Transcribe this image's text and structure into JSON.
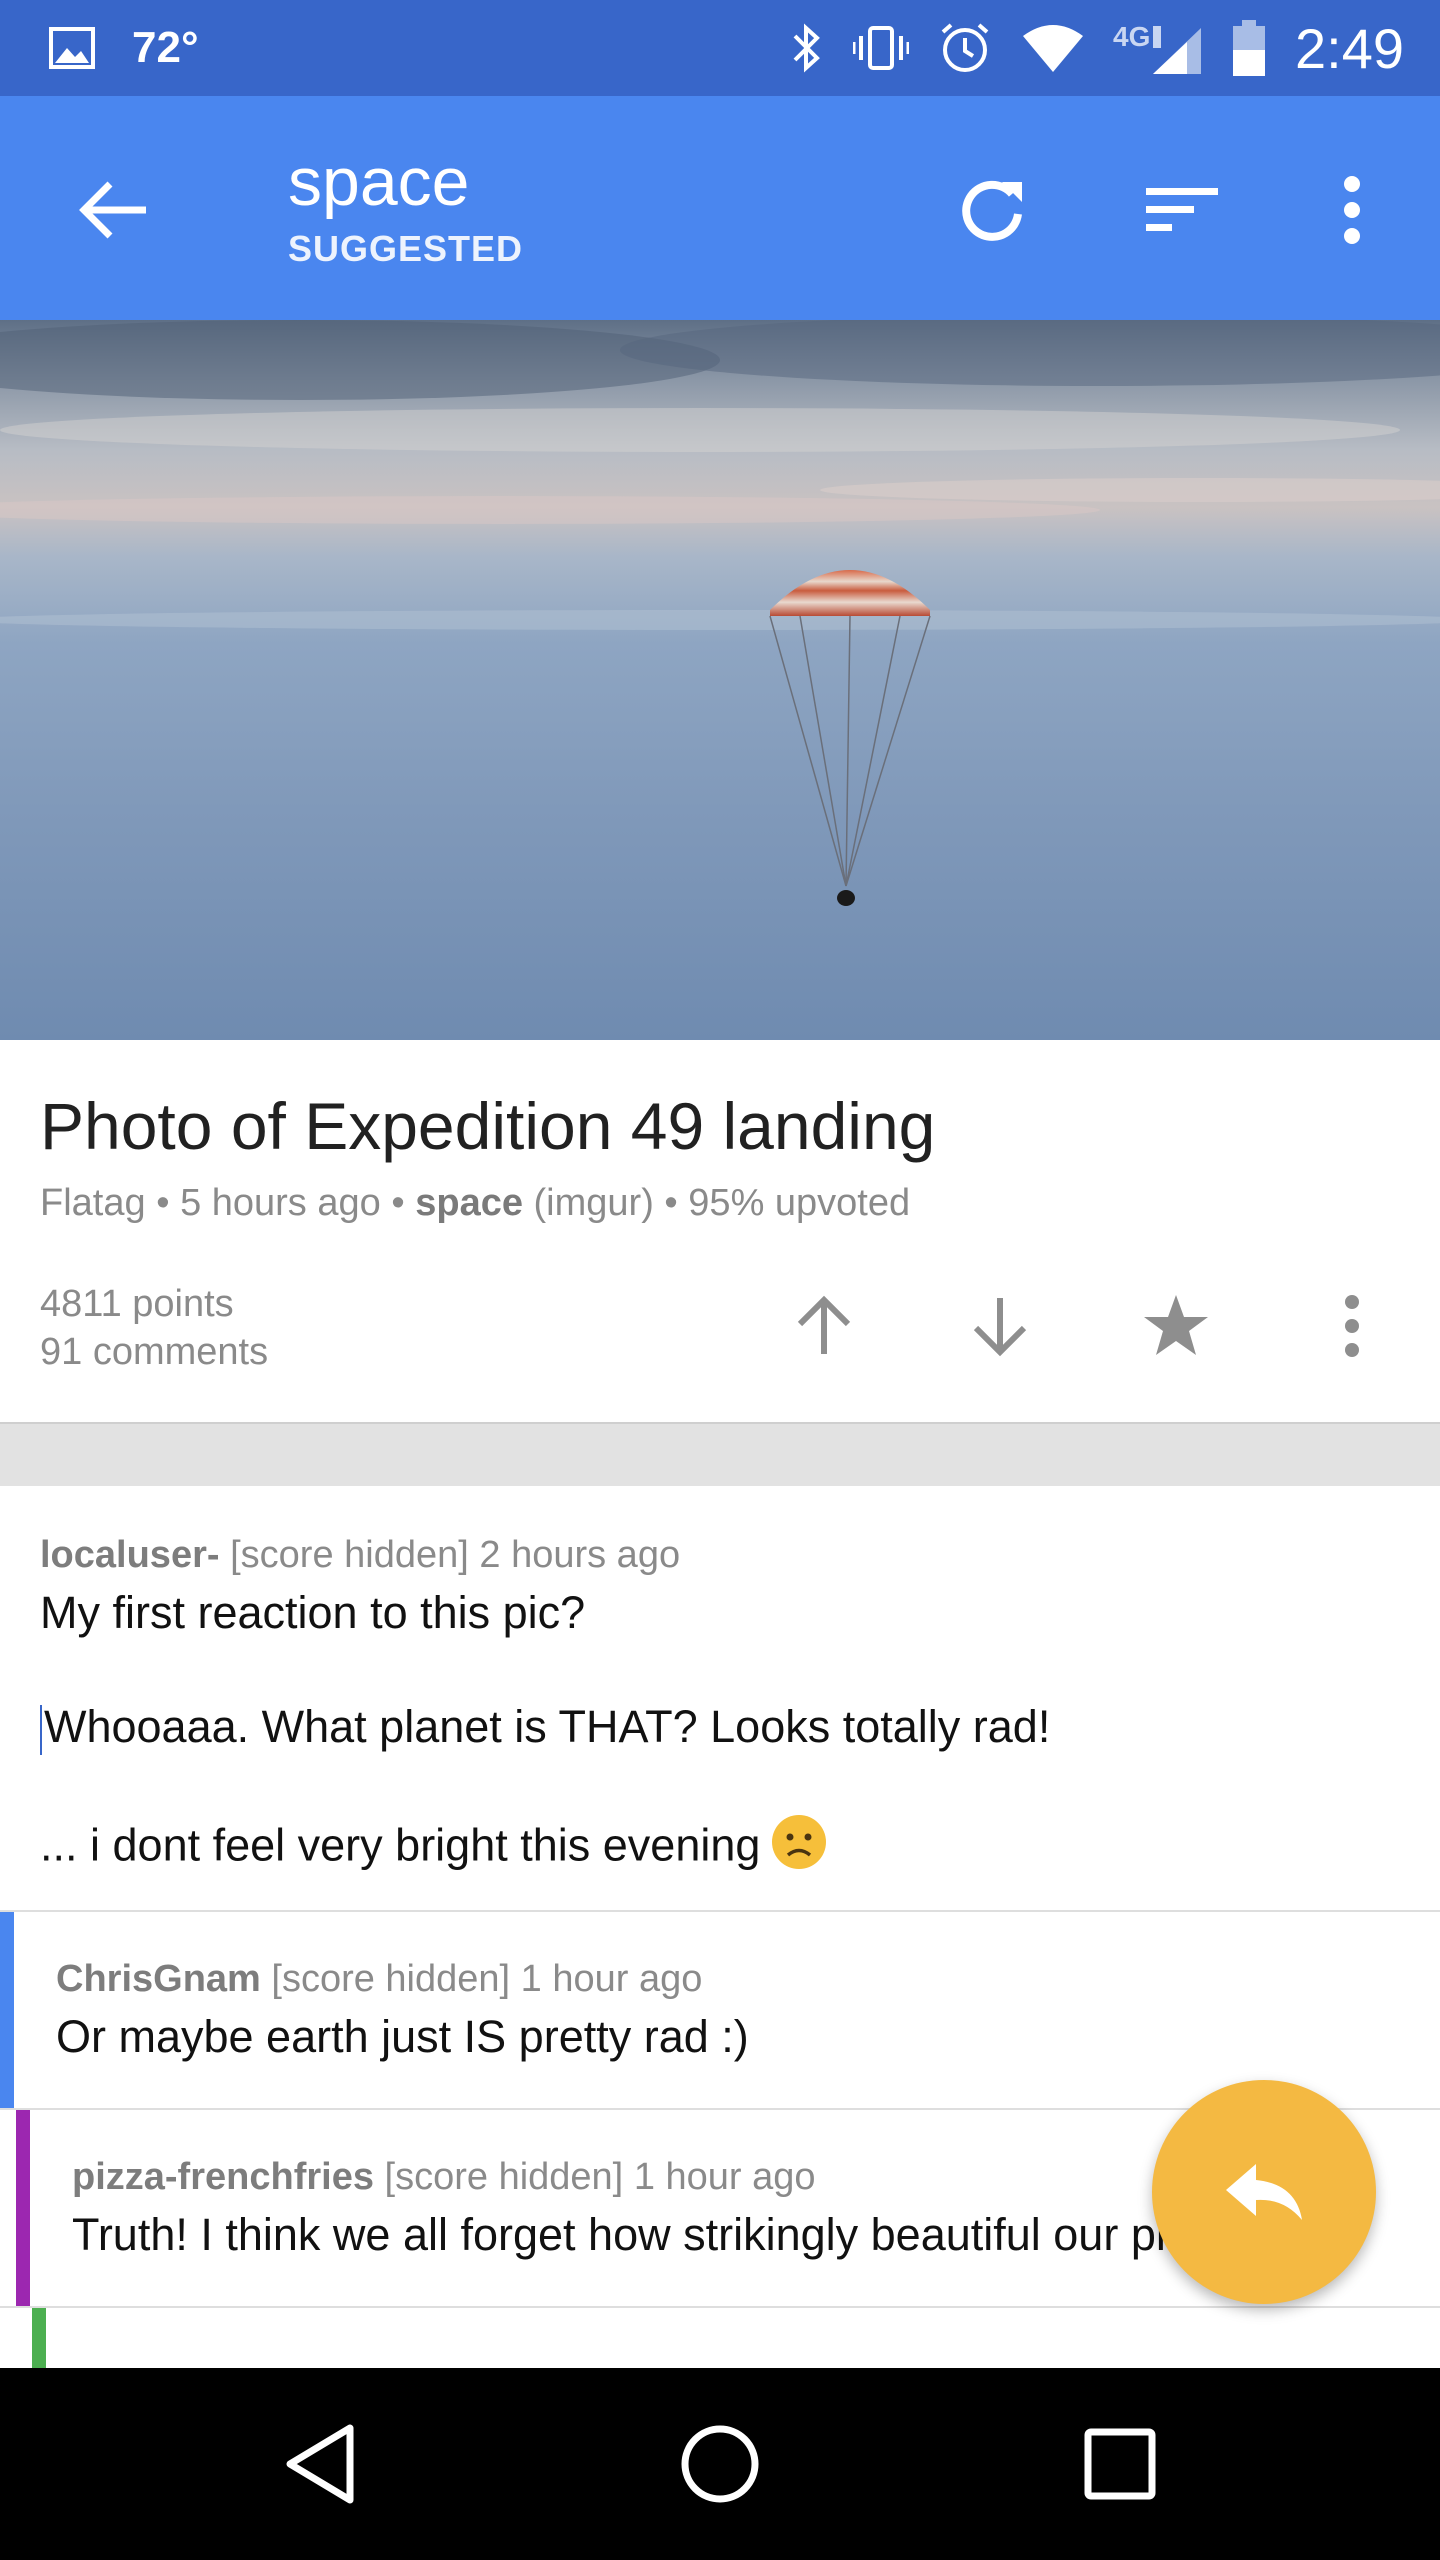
{
  "status_bar": {
    "temperature": "72°",
    "network": "4G LTE",
    "time": "2:49",
    "icons": [
      "image-icon",
      "bluetooth-icon",
      "vibrate-icon",
      "alarm-icon",
      "wifi-icon",
      "signal-icon",
      "battery-icon"
    ]
  },
  "app_bar": {
    "title": "space",
    "subtitle": "SUGGESTED",
    "color": "#4a86ef",
    "actions": [
      "back-arrow-icon",
      "refresh-icon",
      "sort-icon",
      "more-vert-icon"
    ]
  },
  "post": {
    "title": "Photo of Expedition 49 landing",
    "author": "Flatag",
    "age": "5 hours ago",
    "subreddit": "space",
    "domain": "(imgur)",
    "upvoted": "95% upvoted",
    "sep": "•",
    "points": "4811 points",
    "comments": "91 comments",
    "actions": [
      "upvote-icon",
      "downvote-icon",
      "star-icon",
      "more-vert-icon"
    ]
  },
  "comments": [
    {
      "author": "localuser-",
      "score": "[score hidden]",
      "age": "2 hours ago",
      "lines": [
        "My first reaction to this pic?",
        "Whooaaa. What planet is THAT? Looks totally rad!",
        "... i dont feel very bright this evening"
      ],
      "depth_color": ""
    },
    {
      "author": "ChrisGnam",
      "score": "[score hidden]",
      "age": "1 hour ago",
      "text": "Or maybe earth just IS pretty rad :)",
      "depth_color": "#4a86ef"
    },
    {
      "author": "pizza-frenchfries",
      "score": "[score hidden]",
      "age": "1 hour ago",
      "text": "Truth! I think we all forget how strikingly beautiful our planet is",
      "depth_color": "#9c27b0"
    },
    {
      "depth_color": "#4caf50"
    }
  ],
  "fab": {
    "icon": "reply-icon",
    "color": "#f4b942"
  },
  "nav_bar": {
    "icons": [
      "nav-back-icon",
      "nav-home-icon",
      "nav-recents-icon"
    ]
  }
}
